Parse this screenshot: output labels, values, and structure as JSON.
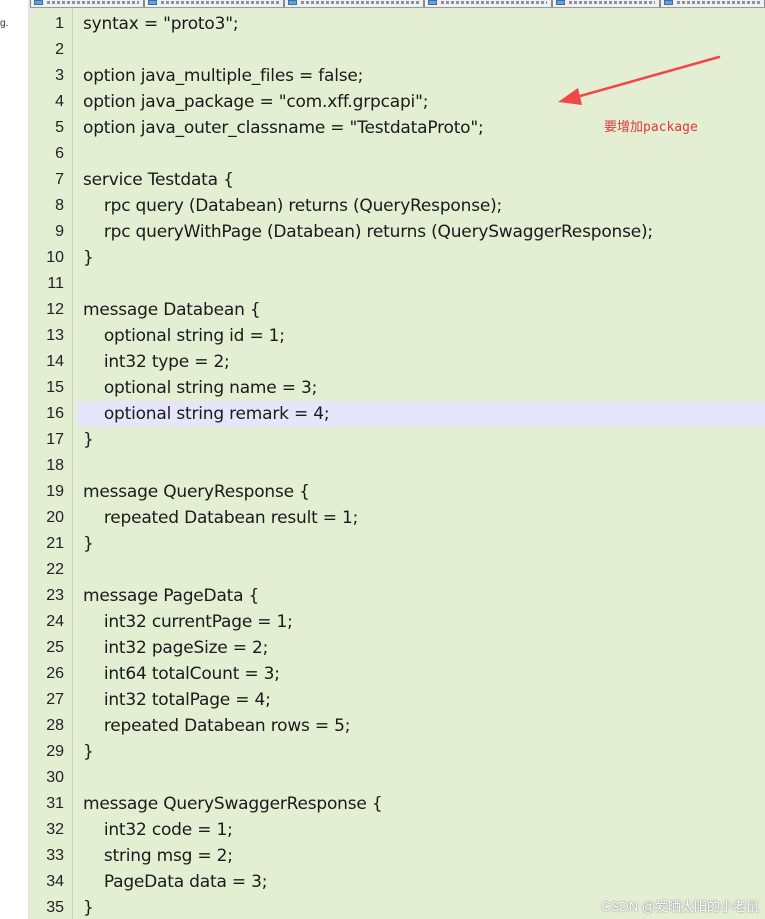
{
  "left_panel": {
    "fragment": "g."
  },
  "tabs": [
    {
      "icon": "file-icon"
    },
    {
      "icon": "file-icon"
    },
    {
      "icon": "file-icon"
    },
    {
      "icon": "file-icon"
    },
    {
      "icon": "file-icon"
    },
    {
      "icon": "file-icon"
    }
  ],
  "editor": {
    "highlighted_line": 16,
    "lines": [
      {
        "num": "1",
        "text": "syntax = \"proto3\";"
      },
      {
        "num": "2",
        "text": ""
      },
      {
        "num": "3",
        "text": "option java_multiple_files = false;"
      },
      {
        "num": "4",
        "text": "option java_package = \"com.xff.grpcapi\";"
      },
      {
        "num": "5",
        "text": "option java_outer_classname = \"TestdataProto\";"
      },
      {
        "num": "6",
        "text": ""
      },
      {
        "num": "7",
        "text": "service Testdata {"
      },
      {
        "num": "8",
        "text": "    rpc query (Databean) returns (QueryResponse);"
      },
      {
        "num": "9",
        "text": "    rpc queryWithPage (Databean) returns (QuerySwaggerResponse);"
      },
      {
        "num": "10",
        "text": "}"
      },
      {
        "num": "11",
        "text": ""
      },
      {
        "num": "12",
        "text": "message Databean {"
      },
      {
        "num": "13",
        "text": "    optional string id = 1;"
      },
      {
        "num": "14",
        "text": "    int32 type = 2;"
      },
      {
        "num": "15",
        "text": "    optional string name = 3;"
      },
      {
        "num": "16",
        "text": "    optional string remark = 4;"
      },
      {
        "num": "17",
        "text": "}"
      },
      {
        "num": "18",
        "text": ""
      },
      {
        "num": "19",
        "text": "message QueryResponse {"
      },
      {
        "num": "20",
        "text": "    repeated Databean result = 1;"
      },
      {
        "num": "21",
        "text": "}"
      },
      {
        "num": "22",
        "text": ""
      },
      {
        "num": "23",
        "text": "message PageData {"
      },
      {
        "num": "24",
        "text": "    int32 currentPage = 1;"
      },
      {
        "num": "25",
        "text": "    int32 pageSize = 2;"
      },
      {
        "num": "26",
        "text": "    int64 totalCount = 3;"
      },
      {
        "num": "27",
        "text": "    int32 totalPage = 4;"
      },
      {
        "num": "28",
        "text": "    repeated Databean rows = 5;"
      },
      {
        "num": "29",
        "text": "}"
      },
      {
        "num": "30",
        "text": ""
      },
      {
        "num": "31",
        "text": "message QuerySwaggerResponse {"
      },
      {
        "num": "32",
        "text": "    int32 code = 1;"
      },
      {
        "num": "33",
        "text": "    string msg = 2;"
      },
      {
        "num": "34",
        "text": "    PageData data = 3;"
      },
      {
        "num": "35",
        "text": "}"
      }
    ]
  },
  "annotation": {
    "text": "要增加package",
    "color": "#e03a3a"
  },
  "watermark": "CSDN @爱晒太阳的小老鼠",
  "colors": {
    "editor_background": "#e3eed3",
    "highlight_line": "#e6e6fa"
  }
}
